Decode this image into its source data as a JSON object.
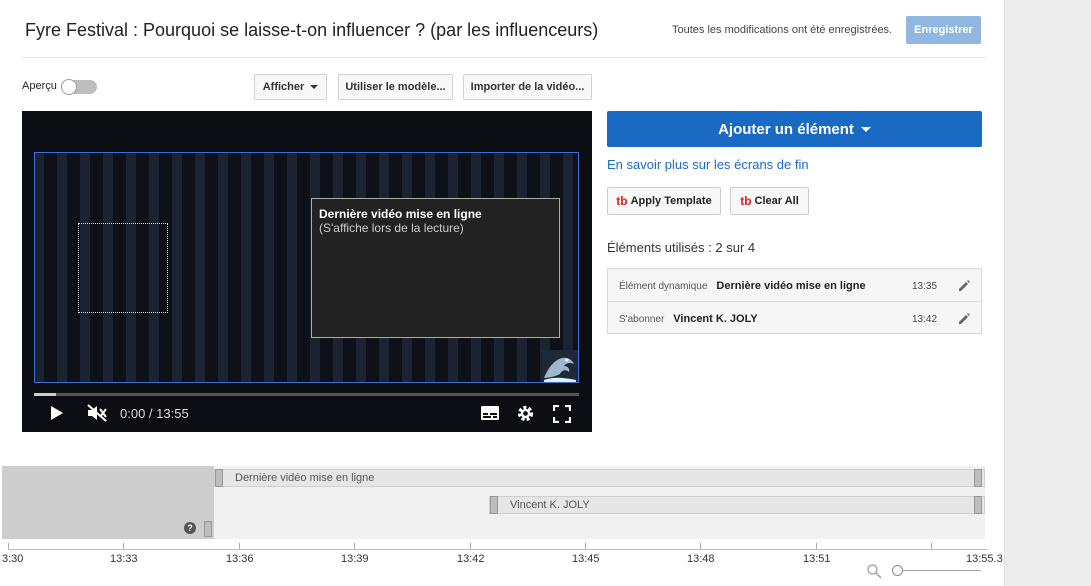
{
  "header": {
    "title": "Fyre Festival : Pourquoi se laisse-t-on influencer ? (par les influenceurs)",
    "save_status": "Toutes les modifications ont été enregistrées.",
    "save_label": "Enregistrer"
  },
  "toolbar": {
    "preview_label": "Aperçu",
    "preview_on": false,
    "show_label": "Afficher",
    "use_template_label": "Utiliser le modèle...",
    "import_video_label": "Importer de la vidéo..."
  },
  "player": {
    "element_title": "Dernière vidéo mise en ligne",
    "element_subtitle": "(S'affiche lors de la lecture)",
    "time": "0:00 / 13:55",
    "progress_fraction": 0.04
  },
  "side": {
    "add_element_label": "Ajouter un élément",
    "learn_more": "En savoir plus sur les écrans de fin",
    "apply_template_label": "Apply Template",
    "clear_all_label": "Clear All",
    "tb_logo": "tb",
    "used_count": "Éléments utilisés : 2 sur 4",
    "elements": [
      {
        "type": "Élément dynamique",
        "name": "Dernière vidéo mise en ligne",
        "time": "13:35"
      },
      {
        "type": "S'abonner",
        "name": "Vincent K. JOLY",
        "time": "13:42"
      }
    ]
  },
  "timeline": {
    "tracks": [
      "Dernière vidéo mise en ligne",
      "Vincent K. JOLY"
    ],
    "help": "?",
    "ticks": [
      "3:30",
      "13:33",
      "13:36",
      "13:39",
      "13:42",
      "13:45",
      "13:48",
      "13:51",
      "13:55.3"
    ]
  },
  "colors": {
    "accent": "#1a6ac4",
    "save_disabled": "#90b7e0",
    "tb_red": "#e0201c"
  }
}
